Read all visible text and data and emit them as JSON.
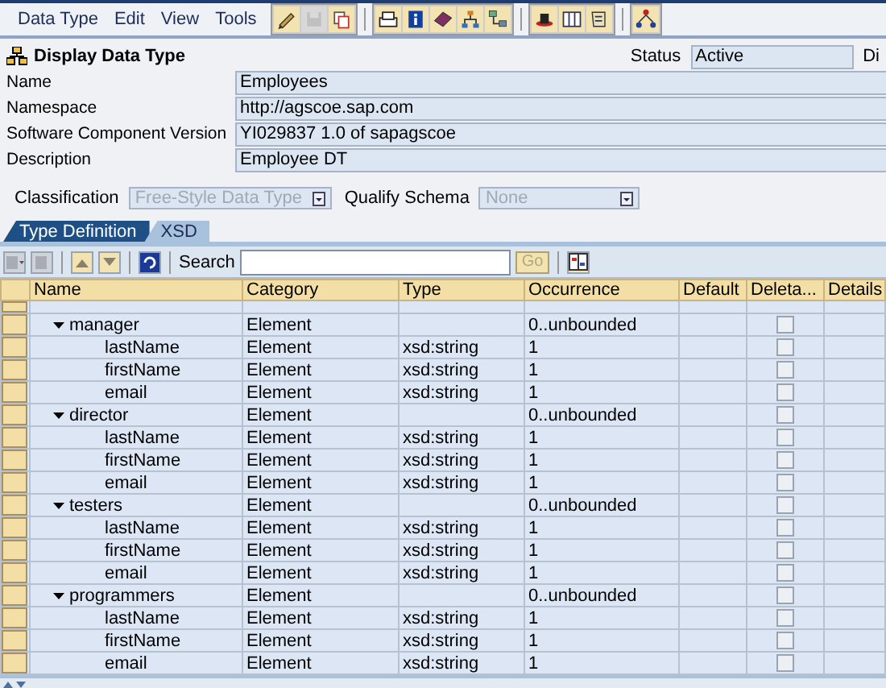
{
  "menu": [
    "Data Type",
    "Edit",
    "View",
    "Tools"
  ],
  "toolbar": [
    [
      {
        "kind": "pencil",
        "disabled": false
      },
      {
        "kind": "save",
        "disabled": true
      },
      {
        "kind": "copy",
        "disabled": false
      }
    ],
    [
      {
        "kind": "print",
        "disabled": false
      },
      {
        "kind": "info",
        "disabled": false
      },
      {
        "kind": "book",
        "disabled": false
      },
      {
        "kind": "hierarchy",
        "disabled": false
      },
      {
        "kind": "network",
        "disabled": false
      }
    ],
    [
      {
        "kind": "hat",
        "disabled": false
      },
      {
        "kind": "columns",
        "disabled": false
      },
      {
        "kind": "scroll",
        "disabled": false
      }
    ],
    [
      {
        "kind": "tree",
        "disabled": false
      }
    ]
  ],
  "title": "Display Data Type",
  "status": {
    "label": "Status",
    "value": "Active",
    "next_label": "Di"
  },
  "fields": [
    {
      "label": "Name",
      "value": "Employees"
    },
    {
      "label": "Namespace",
      "value": "http://agscoe.sap.com"
    },
    {
      "label": "Software Component Version",
      "value": "YI029837 1.0 of sapagscoe"
    },
    {
      "label": "Description",
      "value": "Employee DT"
    }
  ],
  "classification": {
    "label": "Classification",
    "value": "Free-Style Data Type",
    "disabled": true
  },
  "qualify_schema": {
    "label": "Qualify Schema",
    "value": "None",
    "disabled": true
  },
  "tabs": [
    {
      "label": "Type Definition",
      "selected": true
    },
    {
      "label": "XSD",
      "selected": false
    }
  ],
  "search": {
    "label": "Search",
    "button": "Go",
    "button_disabled": true
  },
  "table": {
    "columns": [
      "Name",
      "Category",
      "Type",
      "Occurrence",
      "Default",
      "Deleta...",
      "Details"
    ],
    "rows": [
      {
        "name": "manager",
        "category": "Element",
        "occurrence": "0..unbounded",
        "deletable": false,
        "expanded": true,
        "children": [
          {
            "name": "lastName",
            "category": "Element",
            "type": "xsd:string",
            "occurrence": "1",
            "deletable": false
          },
          {
            "name": "firstName",
            "category": "Element",
            "type": "xsd:string",
            "occurrence": "1",
            "deletable": false
          },
          {
            "name": "email",
            "category": "Element",
            "type": "xsd:string",
            "occurrence": "1",
            "deletable": false
          }
        ]
      },
      {
        "name": "director",
        "category": "Element",
        "occurrence": "0..unbounded",
        "deletable": false,
        "expanded": true,
        "children": [
          {
            "name": "lastName",
            "category": "Element",
            "type": "xsd:string",
            "occurrence": "1",
            "deletable": false
          },
          {
            "name": "firstName",
            "category": "Element",
            "type": "xsd:string",
            "occurrence": "1",
            "deletable": false
          },
          {
            "name": "email",
            "category": "Element",
            "type": "xsd:string",
            "occurrence": "1",
            "deletable": false
          }
        ]
      },
      {
        "name": "testers",
        "category": "Element",
        "occurrence": "0..unbounded",
        "deletable": false,
        "expanded": true,
        "children": [
          {
            "name": "lastName",
            "category": "Element",
            "type": "xsd:string",
            "occurrence": "1",
            "deletable": false
          },
          {
            "name": "firstName",
            "category": "Element",
            "type": "xsd:string",
            "occurrence": "1",
            "deletable": false
          },
          {
            "name": "email",
            "category": "Element",
            "type": "xsd:string",
            "occurrence": "1",
            "deletable": false
          }
        ]
      },
      {
        "name": "programmers",
        "category": "Element",
        "occurrence": "0..unbounded",
        "deletable": false,
        "expanded": true,
        "children": [
          {
            "name": "lastName",
            "category": "Element",
            "type": "xsd:string",
            "occurrence": "1",
            "deletable": false
          },
          {
            "name": "firstName",
            "category": "Element",
            "type": "xsd:string",
            "occurrence": "1",
            "deletable": false
          },
          {
            "name": "email",
            "category": "Element",
            "type": "xsd:string",
            "occurrence": "1",
            "deletable": false
          }
        ]
      }
    ]
  }
}
